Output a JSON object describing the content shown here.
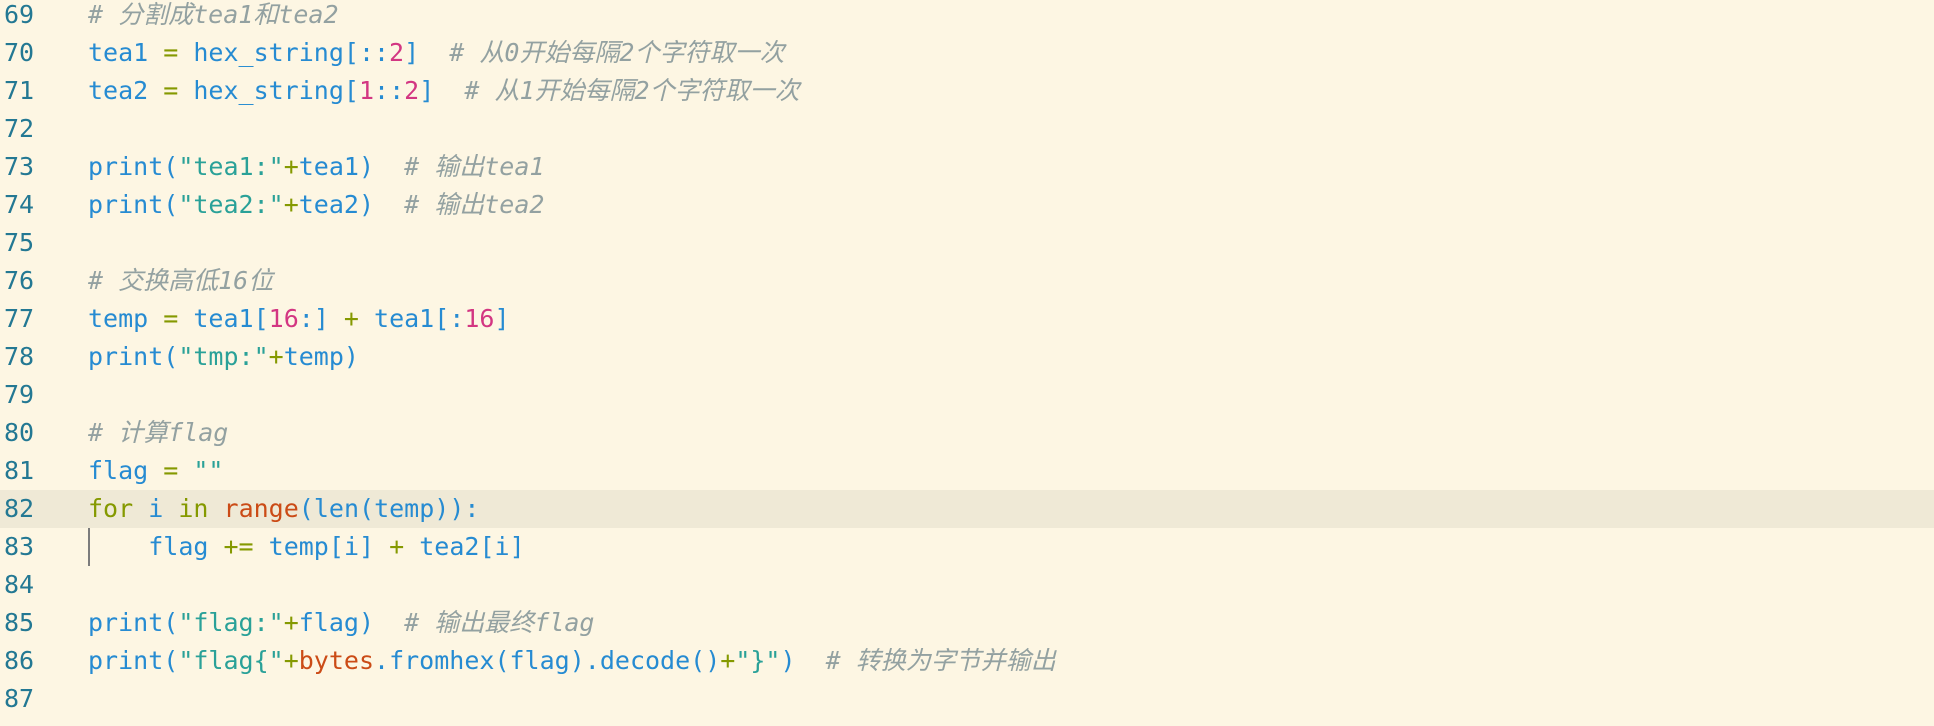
{
  "editor": {
    "colors": {
      "background": "#fdf6e3",
      "current_line": "#efe9d6",
      "line_number": "#237893",
      "variable": "#268bd2",
      "keyword": "#859900",
      "builtin": "#cb4b16",
      "string": "#2aa198",
      "number": "#d33682",
      "comment": "#93a1a1"
    },
    "lines": [
      {
        "num": "69",
        "tokens": [
          {
            "t": "# 分割成tea1和tea2",
            "c": "cm"
          }
        ]
      },
      {
        "num": "70",
        "tokens": [
          {
            "t": "tea1",
            "c": "var"
          },
          {
            "t": " = ",
            "c": "op"
          },
          {
            "t": "hex_string",
            "c": "var"
          },
          {
            "t": "[::",
            "c": "punc"
          },
          {
            "t": "2",
            "c": "num"
          },
          {
            "t": "]",
            "c": "punc"
          },
          {
            "t": "  ",
            "c": "plain"
          },
          {
            "t": "# 从0开始每隔2个字符取一次",
            "c": "cm"
          }
        ]
      },
      {
        "num": "71",
        "tokens": [
          {
            "t": "tea2",
            "c": "var"
          },
          {
            "t": " = ",
            "c": "op"
          },
          {
            "t": "hex_string",
            "c": "var"
          },
          {
            "t": "[",
            "c": "punc"
          },
          {
            "t": "1",
            "c": "num"
          },
          {
            "t": "::",
            "c": "punc"
          },
          {
            "t": "2",
            "c": "num"
          },
          {
            "t": "]",
            "c": "punc"
          },
          {
            "t": "  ",
            "c": "plain"
          },
          {
            "t": "# 从1开始每隔2个字符取一次",
            "c": "cm"
          }
        ]
      },
      {
        "num": "72",
        "tokens": []
      },
      {
        "num": "73",
        "tokens": [
          {
            "t": "print",
            "c": "fn"
          },
          {
            "t": "(",
            "c": "punc"
          },
          {
            "t": "\"tea1:\"",
            "c": "str"
          },
          {
            "t": "+",
            "c": "op"
          },
          {
            "t": "tea1",
            "c": "var"
          },
          {
            "t": ")",
            "c": "punc"
          },
          {
            "t": "  ",
            "c": "plain"
          },
          {
            "t": "# 输出tea1",
            "c": "cm"
          }
        ]
      },
      {
        "num": "74",
        "tokens": [
          {
            "t": "print",
            "c": "fn"
          },
          {
            "t": "(",
            "c": "punc"
          },
          {
            "t": "\"tea2:\"",
            "c": "str"
          },
          {
            "t": "+",
            "c": "op"
          },
          {
            "t": "tea2",
            "c": "var"
          },
          {
            "t": ")",
            "c": "punc"
          },
          {
            "t": "  ",
            "c": "plain"
          },
          {
            "t": "# 输出tea2",
            "c": "cm"
          }
        ]
      },
      {
        "num": "75",
        "tokens": []
      },
      {
        "num": "76",
        "tokens": [
          {
            "t": "# 交换高低16位",
            "c": "cm"
          }
        ]
      },
      {
        "num": "77",
        "tokens": [
          {
            "t": "temp",
            "c": "var"
          },
          {
            "t": " = ",
            "c": "op"
          },
          {
            "t": "tea1",
            "c": "var"
          },
          {
            "t": "[",
            "c": "punc"
          },
          {
            "t": "16",
            "c": "num"
          },
          {
            "t": ":]",
            "c": "punc"
          },
          {
            "t": " + ",
            "c": "op"
          },
          {
            "t": "tea1",
            "c": "var"
          },
          {
            "t": "[:",
            "c": "punc"
          },
          {
            "t": "16",
            "c": "num"
          },
          {
            "t": "]",
            "c": "punc"
          }
        ]
      },
      {
        "num": "78",
        "tokens": [
          {
            "t": "print",
            "c": "fn"
          },
          {
            "t": "(",
            "c": "punc"
          },
          {
            "t": "\"tmp:\"",
            "c": "str"
          },
          {
            "t": "+",
            "c": "op"
          },
          {
            "t": "temp",
            "c": "var"
          },
          {
            "t": ")",
            "c": "punc"
          }
        ]
      },
      {
        "num": "79",
        "tokens": []
      },
      {
        "num": "80",
        "tokens": [
          {
            "t": "# 计算flag",
            "c": "cm"
          }
        ]
      },
      {
        "num": "81",
        "tokens": [
          {
            "t": "flag",
            "c": "var"
          },
          {
            "t": " = ",
            "c": "op"
          },
          {
            "t": "\"\"",
            "c": "str"
          }
        ]
      },
      {
        "num": "82",
        "current": true,
        "tokens": [
          {
            "t": "for",
            "c": "kw"
          },
          {
            "t": " ",
            "c": "plain"
          },
          {
            "t": "i",
            "c": "var"
          },
          {
            "t": " ",
            "c": "plain"
          },
          {
            "t": "in",
            "c": "kw"
          },
          {
            "t": " ",
            "c": "plain"
          },
          {
            "t": "range",
            "c": "bi"
          },
          {
            "t": "(",
            "c": "punc"
          },
          {
            "t": "len",
            "c": "fn"
          },
          {
            "t": "(",
            "c": "punc"
          },
          {
            "t": "temp",
            "c": "var"
          },
          {
            "t": ")):",
            "c": "punc"
          }
        ]
      },
      {
        "num": "83",
        "indent": true,
        "tokens": [
          {
            "t": "    ",
            "c": "plain"
          },
          {
            "t": "flag",
            "c": "var"
          },
          {
            "t": " += ",
            "c": "op"
          },
          {
            "t": "temp",
            "c": "var"
          },
          {
            "t": "[",
            "c": "punc"
          },
          {
            "t": "i",
            "c": "var"
          },
          {
            "t": "]",
            "c": "punc"
          },
          {
            "t": " + ",
            "c": "op"
          },
          {
            "t": "tea2",
            "c": "var"
          },
          {
            "t": "[",
            "c": "punc"
          },
          {
            "t": "i",
            "c": "var"
          },
          {
            "t": "]",
            "c": "punc"
          }
        ]
      },
      {
        "num": "84",
        "tokens": []
      },
      {
        "num": "85",
        "tokens": [
          {
            "t": "print",
            "c": "fn"
          },
          {
            "t": "(",
            "c": "punc"
          },
          {
            "t": "\"flag:\"",
            "c": "str"
          },
          {
            "t": "+",
            "c": "op"
          },
          {
            "t": "flag",
            "c": "var"
          },
          {
            "t": ")",
            "c": "punc"
          },
          {
            "t": "  ",
            "c": "plain"
          },
          {
            "t": "# 输出最终flag",
            "c": "cm"
          }
        ]
      },
      {
        "num": "86",
        "tokens": [
          {
            "t": "print",
            "c": "fn"
          },
          {
            "t": "(",
            "c": "punc"
          },
          {
            "t": "\"flag{\"",
            "c": "str"
          },
          {
            "t": "+",
            "c": "op"
          },
          {
            "t": "bytes",
            "c": "bi"
          },
          {
            "t": ".",
            "c": "punc"
          },
          {
            "t": "fromhex",
            "c": "fn"
          },
          {
            "t": "(",
            "c": "punc"
          },
          {
            "t": "flag",
            "c": "var"
          },
          {
            "t": ")",
            "c": "punc"
          },
          {
            "t": ".",
            "c": "punc"
          },
          {
            "t": "decode",
            "c": "fn"
          },
          {
            "t": "()",
            "c": "punc"
          },
          {
            "t": "+",
            "c": "op"
          },
          {
            "t": "\"}\"",
            "c": "str"
          },
          {
            "t": ")",
            "c": "punc"
          },
          {
            "t": "  ",
            "c": "plain"
          },
          {
            "t": "# 转换为字节并输出",
            "c": "cm"
          }
        ]
      },
      {
        "num": "87",
        "tokens": []
      }
    ]
  }
}
